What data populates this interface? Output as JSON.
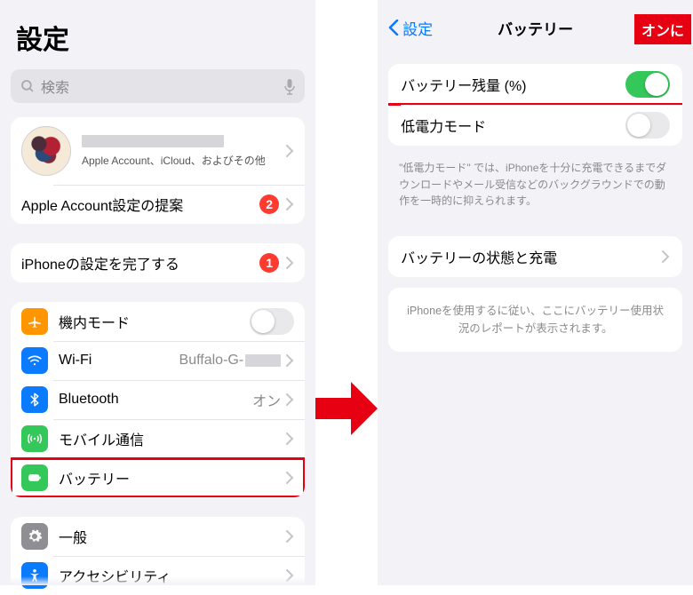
{
  "left": {
    "title": "設定",
    "search_placeholder": "検索",
    "profile_sub": "Apple Account、iCloud、およびその他",
    "suggestion_label": "Apple Account設定の提案",
    "suggestion_badge": "2",
    "finish_setup_label": "iPhoneの設定を完了する",
    "finish_setup_badge": "1",
    "rows": {
      "airplane": "機内モード",
      "wifi": "Wi-Fi",
      "wifi_value_prefix": "Buffalo-G-",
      "bluetooth": "Bluetooth",
      "bluetooth_value": "オン",
      "cellular": "モバイル通信",
      "battery": "バッテリー",
      "general": "一般",
      "accessibility": "アクセシビリティ"
    }
  },
  "right": {
    "back": "設定",
    "title": "バッテリー",
    "callout_tag": "オンに",
    "pct_label": "バッテリー残量 (%)",
    "lpm_label": "低電力モード",
    "lpm_footer": "\"低電力モード\" では、iPhoneを十分に充電できるまでダウンロードやメール受信などのバックグラウンドでの動作を一時的に抑えられます。",
    "health_label": "バッテリーの状態と充電",
    "usage_placeholder": "iPhoneを使用するに従い、ここにバッテリー使用状況のレポートが表示されます。"
  }
}
